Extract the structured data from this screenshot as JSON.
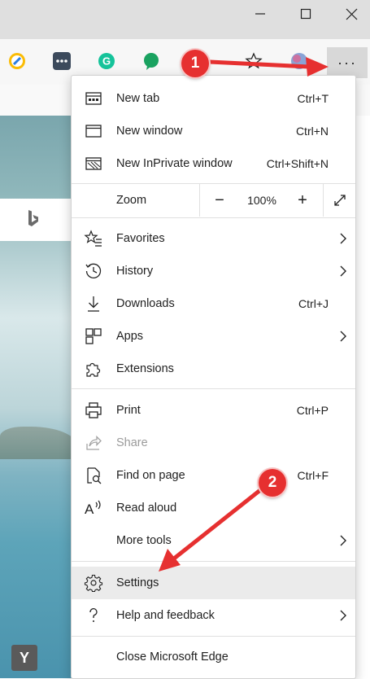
{
  "menu": {
    "new_tab": {
      "label": "New tab",
      "shortcut": "Ctrl+T"
    },
    "new_window": {
      "label": "New window",
      "shortcut": "Ctrl+N"
    },
    "inprivate": {
      "label": "New InPrivate window",
      "shortcut": "Ctrl+Shift+N"
    },
    "zoom": {
      "label": "Zoom",
      "value": "100%",
      "minus": "−",
      "plus": "+"
    },
    "favorites": {
      "label": "Favorites"
    },
    "history": {
      "label": "History"
    },
    "downloads": {
      "label": "Downloads",
      "shortcut": "Ctrl+J"
    },
    "apps": {
      "label": "Apps"
    },
    "extensions": {
      "label": "Extensions"
    },
    "print": {
      "label": "Print",
      "shortcut": "Ctrl+P"
    },
    "share": {
      "label": "Share"
    },
    "find": {
      "label": "Find on page",
      "shortcut": "Ctrl+F"
    },
    "read_aloud": {
      "label": "Read aloud"
    },
    "more_tools": {
      "label": "More tools"
    },
    "settings": {
      "label": "Settings"
    },
    "help": {
      "label": "Help and feedback"
    },
    "close": {
      "label": "Close Microsoft Edge"
    }
  },
  "toolbar": {
    "more_label": "···"
  },
  "page": {
    "tile_letter": "Y"
  },
  "callouts": {
    "first": "1",
    "second": "2"
  },
  "colors": {
    "accent_red": "#e63030",
    "highlight": "#ebebeb"
  }
}
